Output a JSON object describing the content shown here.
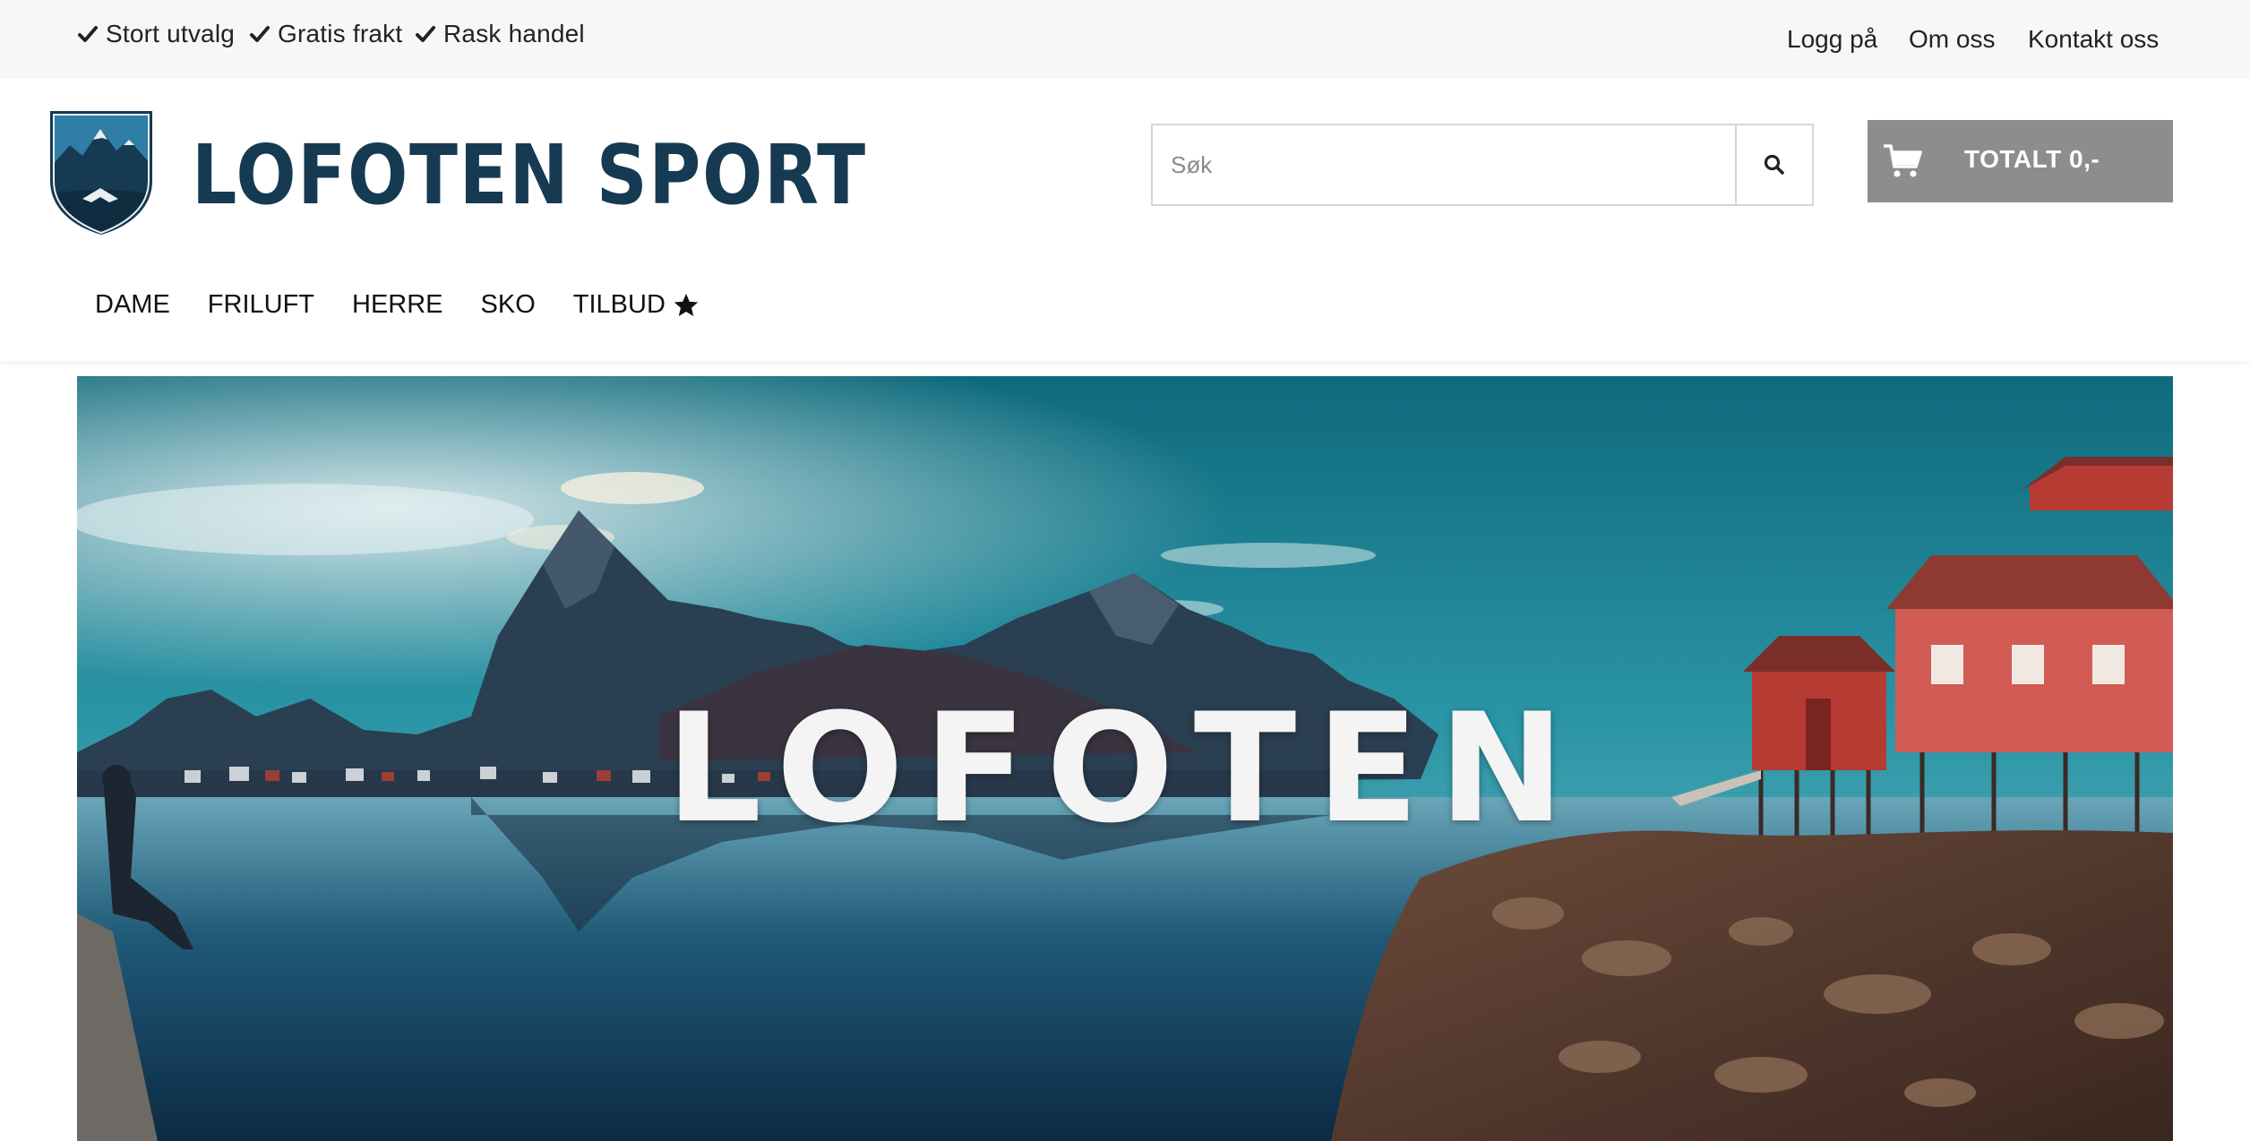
{
  "topbar": {
    "usps": [
      "Stort utvalg",
      "Gratis frakt",
      "Rask handel"
    ],
    "links": [
      "Logg på",
      "Om oss",
      "Kontakt oss"
    ]
  },
  "header": {
    "brand": "LOFOTEN SPORT",
    "brand_color": "#163a52",
    "search_placeholder": "Søk",
    "search_value": "",
    "cart_label": "TOTALT 0,-",
    "cart_bg": "#8d8d8d"
  },
  "nav": {
    "items": [
      "DAME",
      "FRILUFT",
      "HERRE",
      "SKO",
      "TILBUD"
    ],
    "tilbud_icon": "star-icon"
  },
  "hero": {
    "title": "LOFOTEN"
  }
}
